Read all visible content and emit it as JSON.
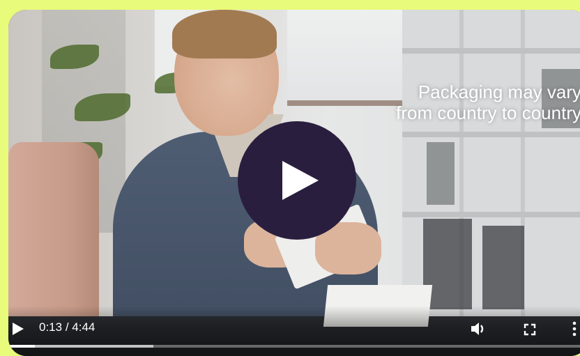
{
  "video": {
    "overlay_line1": "Packaging may vary",
    "overlay_line2": "from country to country",
    "current_time": "0:13",
    "time_separator": " / ",
    "duration": "4:44",
    "played_fraction": 0.046,
    "buffered_fraction": 0.25
  },
  "icons": {
    "big_play": "play-icon",
    "play": "play-icon",
    "volume": "volume-icon",
    "fullscreen": "fullscreen-icon",
    "more": "more-options-icon"
  },
  "colors": {
    "page_background": "#e9fb7a",
    "play_button": "#2a1e3f",
    "control_text": "#ffffff"
  }
}
